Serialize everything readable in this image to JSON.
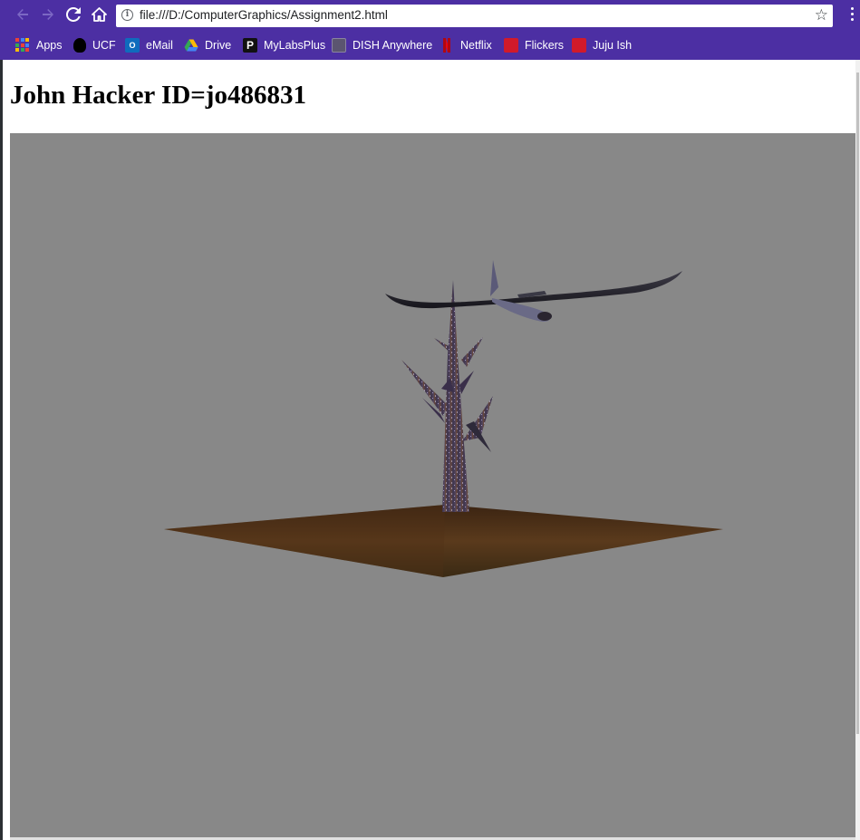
{
  "browser": {
    "url": "file:///D:/ComputerGraphics/Assignment2.html",
    "accent_color": "#4c2fa3",
    "nav": {
      "back_icon": "arrow-left-icon",
      "forward_icon": "arrow-right-icon",
      "reload_icon": "reload-icon",
      "home_icon": "home-icon",
      "info_icon": "info-icon",
      "star_icon": "star-icon",
      "menu_icon": "kebab-menu-icon"
    },
    "bookmarks": [
      {
        "label": "Apps",
        "icon": "apps-grid-icon"
      },
      {
        "label": "UCF",
        "icon": "ucf-icon"
      },
      {
        "label": "eMail",
        "icon": "outlook-icon"
      },
      {
        "label": "Drive",
        "icon": "google-drive-icon"
      },
      {
        "label": "MyLabsPlus",
        "icon": "mylabsplus-icon"
      },
      {
        "label": "DISH Anywhere",
        "icon": "dish-icon"
      },
      {
        "label": "Netflix",
        "icon": "netflix-icon"
      },
      {
        "label": "Flickers",
        "icon": "flickers-icon"
      },
      {
        "label": "Juju Ish",
        "icon": "jujuish-icon"
      }
    ]
  },
  "page": {
    "heading": "John Hacker ID=jo486831",
    "scene": {
      "background_color": "#888888",
      "ground_color": "#4a2f17",
      "tree_color": "#3a2f4a",
      "plane_color": "#2a2a34"
    }
  }
}
